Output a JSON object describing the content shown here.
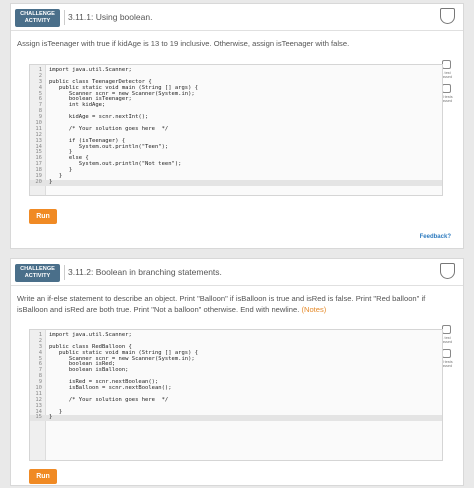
{
  "activity1": {
    "badge_line1": "CHALLENGE",
    "badge_line2": "ACTIVITY",
    "title": "3.11.1: Using boolean.",
    "description": "Assign isTeenager with true if kidAge is 13 to 19 inclusive. Otherwise, assign isTeenager with false.",
    "side_labels": [
      "1 test passed",
      "All tests passed"
    ],
    "code": [
      {
        "n": "1",
        "t": "import java.util.Scanner;"
      },
      {
        "n": "2",
        "t": ""
      },
      {
        "n": "3",
        "t": "public class TeenagerDetector {"
      },
      {
        "n": "4",
        "t": "   public static void main (String [] args) {"
      },
      {
        "n": "5",
        "t": "      Scanner scnr = new Scanner(System.in);"
      },
      {
        "n": "6",
        "t": "      boolean isTeenager;"
      },
      {
        "n": "7",
        "t": "      int kidAge;"
      },
      {
        "n": "8",
        "t": ""
      },
      {
        "n": "9",
        "t": "      kidAge = scnr.nextInt();"
      },
      {
        "n": "10",
        "t": ""
      },
      {
        "n": "11",
        "t": "      /* Your solution goes here  */"
      },
      {
        "n": "12",
        "t": ""
      },
      {
        "n": "13",
        "t": "      if (isTeenager) {"
      },
      {
        "n": "14",
        "t": "         System.out.println(\"Teen\");"
      },
      {
        "n": "15",
        "t": "      }"
      },
      {
        "n": "16",
        "t": "      else {"
      },
      {
        "n": "17",
        "t": "         System.out.println(\"Not teen\");"
      },
      {
        "n": "18",
        "t": "      }"
      },
      {
        "n": "19",
        "t": "   }"
      },
      {
        "n": "20",
        "t": "}"
      }
    ],
    "active_line": "20",
    "run_label": "Run",
    "feedback_label": "Feedback?"
  },
  "activity2": {
    "badge_line1": "CHALLENGE",
    "badge_line2": "ACTIVITY",
    "title": "3.11.2: Boolean in branching statements.",
    "description": "Write an if-else statement to describe an object. Print \"Balloon\" if isBalloon is true and isRed is false. Print \"Red balloon\" if isBalloon and isRed are both true. Print \"Not a balloon\" otherwise. End with newline.",
    "notes_label": "(Notes)",
    "side_labels": [
      "1 test passed",
      "All tests passed"
    ],
    "code": [
      {
        "n": "1",
        "t": "import java.util.Scanner;"
      },
      {
        "n": "2",
        "t": ""
      },
      {
        "n": "3",
        "t": "public class RedBalloon {"
      },
      {
        "n": "4",
        "t": "   public static void main (String [] args) {"
      },
      {
        "n": "5",
        "t": "      Scanner scnr = new Scanner(System.in);"
      },
      {
        "n": "6",
        "t": "      boolean isRed;"
      },
      {
        "n": "7",
        "t": "      boolean isBalloon;"
      },
      {
        "n": "8",
        "t": ""
      },
      {
        "n": "9",
        "t": "      isRed = scnr.nextBoolean();"
      },
      {
        "n": "10",
        "t": "      isBalloon = scnr.nextBoolean();"
      },
      {
        "n": "11",
        "t": ""
      },
      {
        "n": "12",
        "t": "      /* Your solution goes here  */"
      },
      {
        "n": "13",
        "t": ""
      },
      {
        "n": "14",
        "t": "   }"
      },
      {
        "n": "15",
        "t": "}"
      }
    ],
    "active_line": "15",
    "run_label": "Run"
  },
  "colors": {
    "badge": "#4a6f8a",
    "run_button": "#f08a24",
    "feedback_link": "#2e7bbf",
    "notes_link": "#e58a2a"
  },
  "icons": [
    "shield-icon",
    "checkbox-icon"
  ]
}
